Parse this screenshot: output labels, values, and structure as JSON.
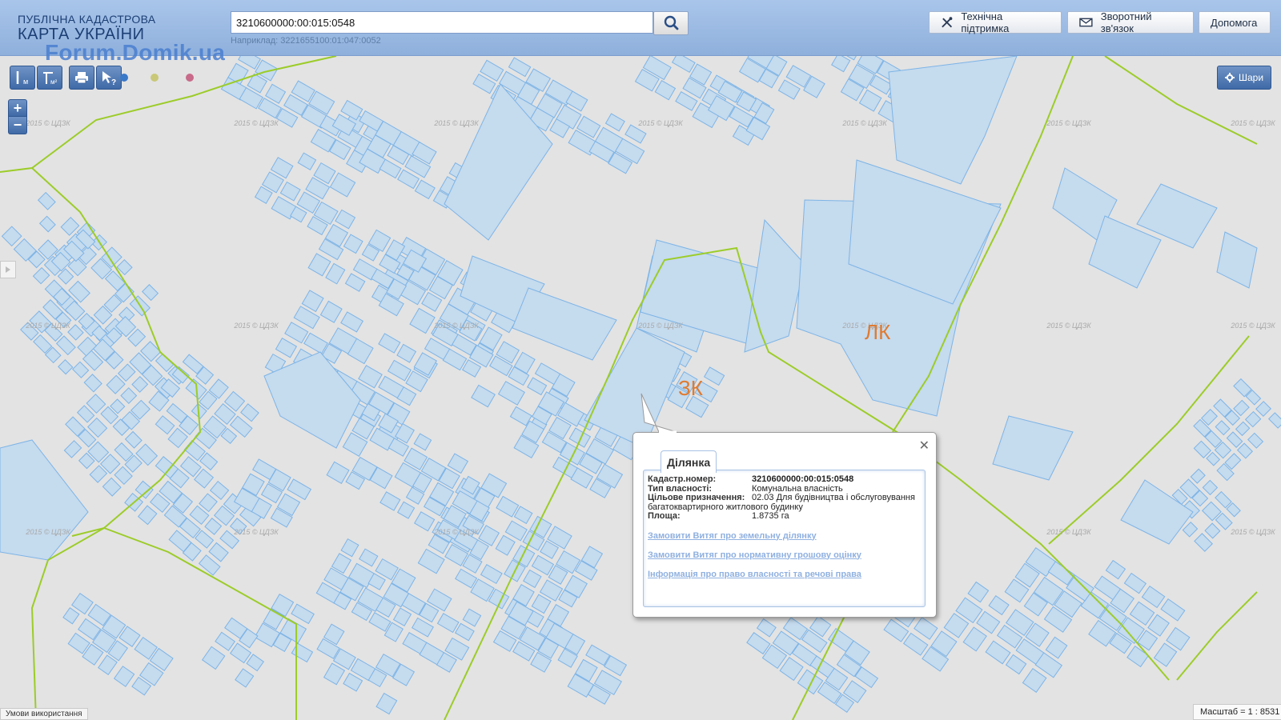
{
  "header": {
    "logo_line1": "ПУБЛІЧНА КАДАСТРОВА",
    "logo_line2": "КАРТА УКРАЇНИ",
    "watermark": "Forum.Domik.ua",
    "search_value": "3210600000:00:015:0548",
    "search_hint": "Наприклад: 3221655100:01:047:0052",
    "support_label": "Технічна підтримка",
    "feedback_label": "Зворотний зв'язок",
    "help_label": "Допомога"
  },
  "toolbar": {
    "tools": [
      "ruler-icon",
      "area-icon",
      "print-icon",
      "identify-icon"
    ],
    "dot_colors": [
      "#3a78c8",
      "#c8c878",
      "#c86a8a"
    ]
  },
  "zoom": {
    "in": "+",
    "out": "−"
  },
  "layers": {
    "label": "Шари"
  },
  "map": {
    "copyright": "2015 © ЦДЗК",
    "labels": {
      "zk": "ЗК",
      "lk": "ЛК"
    },
    "parcel_fill": "#c5dbee",
    "parcel_stroke": "#7db4e6",
    "boundary_color": "#9ccc28"
  },
  "popup": {
    "tab": "Ділянка",
    "rows": [
      {
        "label": "Кадастр.номер:",
        "value": "3210600000:00:015:0548"
      },
      {
        "label": "Тип власності:",
        "value": "Комунальна власність"
      },
      {
        "label": "Цільове призначення:",
        "value": "02.03 Для будівництва і обслуговування"
      },
      {
        "label": "Площа:",
        "value": "1.8735 га"
      }
    ],
    "purpose_cont": "багатоквартирного житлового будинку",
    "links": [
      "Замовити Витяг про земельну ділянку",
      "Замовити Витяг про нормативну грошову оцінку",
      "Інформація про право власності та речові права"
    ]
  },
  "footer": {
    "terms": "Умови використання",
    "scale": "Масштаб = 1 : 8531"
  }
}
